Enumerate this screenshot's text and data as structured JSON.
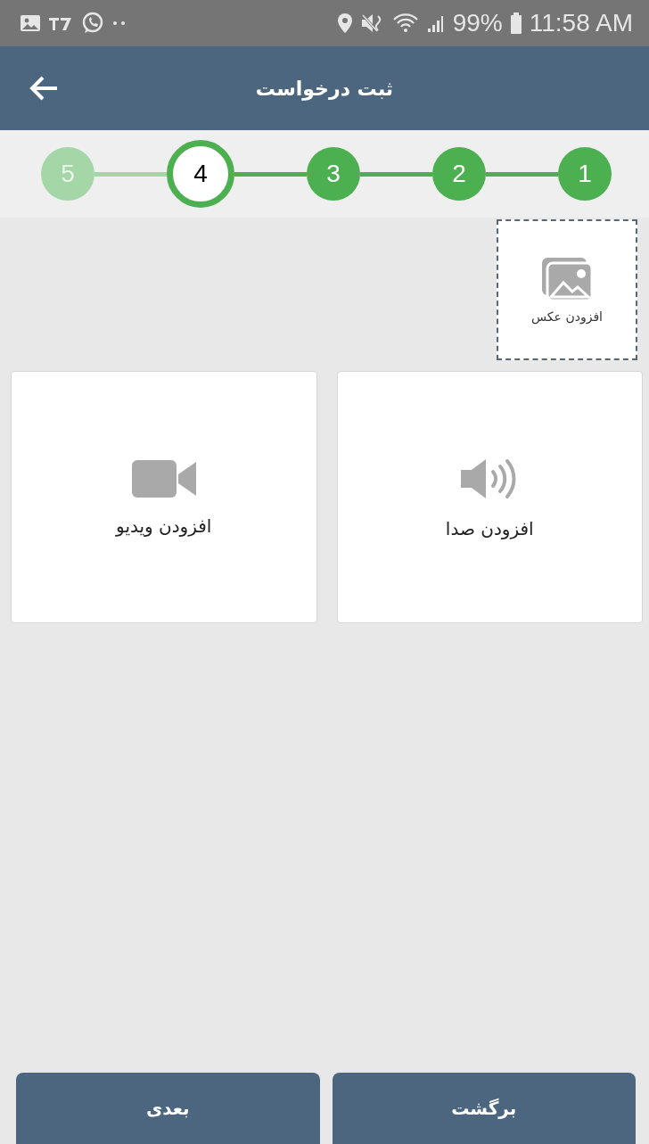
{
  "status_bar": {
    "battery": "99%",
    "time": "11:58 AM"
  },
  "header": {
    "title": "ثبت درخواست"
  },
  "steps": [
    {
      "label": "1",
      "kind": "done"
    },
    {
      "label": "2",
      "kind": "done"
    },
    {
      "label": "3",
      "kind": "done"
    },
    {
      "label": "4",
      "kind": "current"
    },
    {
      "label": "5",
      "kind": "pending"
    }
  ],
  "photo": {
    "label": "افزودن عکس"
  },
  "media": [
    {
      "label": "افزودن صدا",
      "kind": "audio"
    },
    {
      "label": "افزودن ویدیو",
      "kind": "video"
    }
  ],
  "buttons": [
    {
      "label": "برگشت"
    },
    {
      "label": "بعدی"
    }
  ]
}
